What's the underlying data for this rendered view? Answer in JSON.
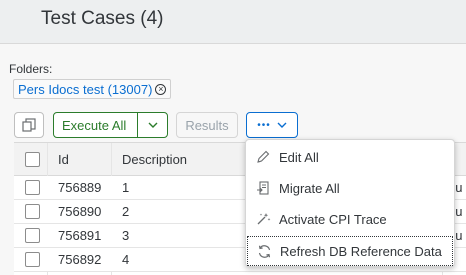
{
  "header": {
    "title": "Test Cases (4)"
  },
  "folders": {
    "label": "Folders:",
    "token": "Pers Idocs test (13007)"
  },
  "toolbar": {
    "execute_label": "Execute All",
    "results_label": "Results",
    "more_label": "•••"
  },
  "table": {
    "columns": {
      "id": "Id",
      "description": "Description"
    },
    "rows": [
      {
        "id": "756889",
        "description": "1",
        "trailing": "ou"
      },
      {
        "id": "756890",
        "description": "2",
        "trailing": "ou"
      },
      {
        "id": "756891",
        "description": "3",
        "trailing": "ou"
      },
      {
        "id": "756892",
        "description": "4",
        "trailing": ""
      }
    ]
  },
  "menu": {
    "items": [
      {
        "label": "Edit All",
        "icon": "pencil-icon"
      },
      {
        "label": "Migrate All",
        "icon": "migrate-icon"
      },
      {
        "label": "Activate CPI Trace",
        "icon": "trace-icon"
      },
      {
        "label": "Refresh DB Reference Data",
        "icon": "refresh-icon"
      }
    ]
  },
  "colors": {
    "accent": "#0a6ed1",
    "positive": "#2b7c2b",
    "header_bg": "#edeff0"
  }
}
